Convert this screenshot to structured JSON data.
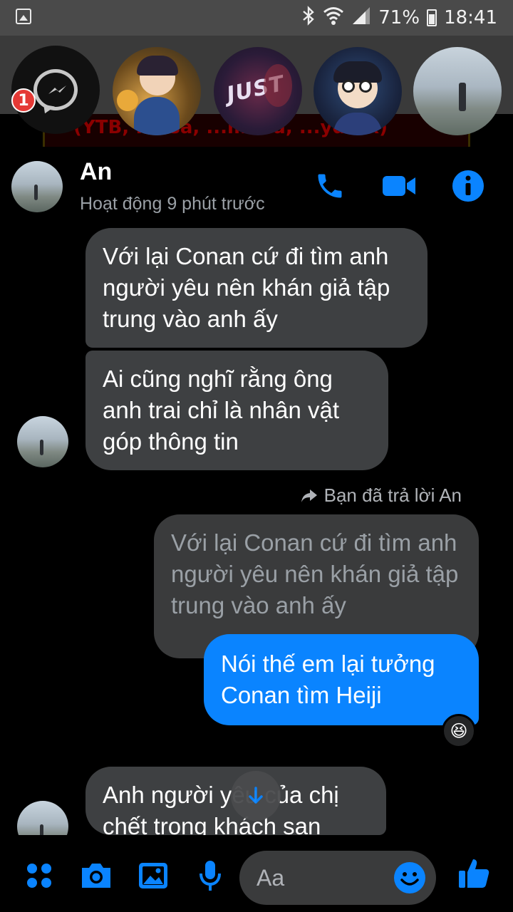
{
  "status_bar": {
    "battery_text": "71%",
    "time": "18:41",
    "icons": [
      "image-icon",
      "bluetooth-icon",
      "wifi-icon",
      "signal-icon",
      "battery-icon"
    ]
  },
  "chat_heads": {
    "messenger_badge": "1",
    "heads": [
      "messenger-head",
      "contact-head-1",
      "contact-head-2",
      "contact-head-3",
      "contact-head-4"
    ],
    "head2_text": "JUST"
  },
  "background_app": {
    "text": "(YTB, ...asa, ...mbed, ...ydrax)"
  },
  "header": {
    "name": "An",
    "status": "Hoạt động 9 phút trước"
  },
  "messages": {
    "m1": "Với lại Conan cứ đi tìm anh người yêu nên khán giả tập trung vào anh ấy",
    "m2": "Ai cũng nghĩ rằng ông anh trai chỉ là nhân vật góp thông tin",
    "reply_note": "Bạn đã trả lời An",
    "quoted": "Với lại Conan cứ đi tìm anh người yêu nên khán giả tập trung vào anh ấy",
    "sent": "Nói thế em lại tưởng Conan tìm Heiji",
    "reaction": "😆",
    "m3": "Anh người yêu của chị chết trong khách sạn"
  },
  "composer": {
    "placeholder": "Aa"
  },
  "colors": {
    "accent": "#0a84ff",
    "bubble_in": "#3e4042",
    "background": "#000000"
  }
}
